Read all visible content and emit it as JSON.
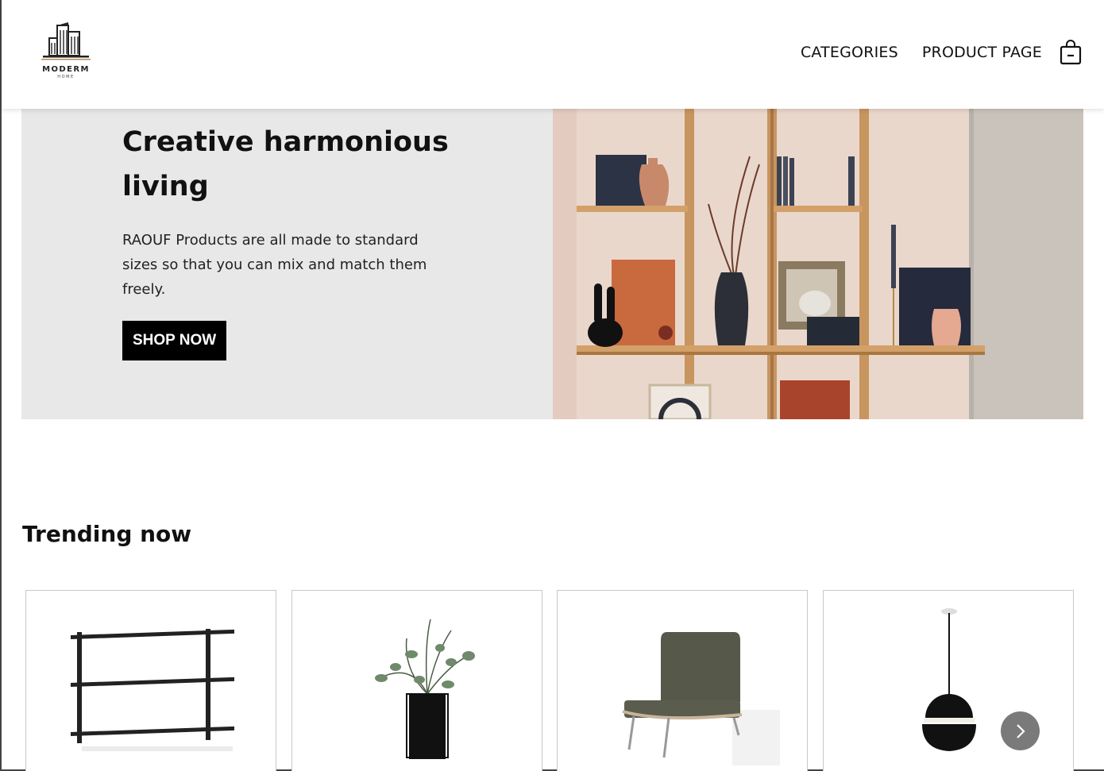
{
  "brand": {
    "name": "MODERM",
    "tagline": "HOME"
  },
  "nav": {
    "categories": "CATEGORIES",
    "product_page": "PRODUCT PAGE",
    "cart_icon": "shopping-bag-icon"
  },
  "hero": {
    "title": "Creative harmonious living",
    "description": "RAOUF Products are all made to standard sizes so that you can mix and match them freely.",
    "cta": "SHOP NOW",
    "background": "#e8e8e8"
  },
  "trending": {
    "title": "Trending now",
    "products": [
      {
        "icon": "wall-shelf-image"
      },
      {
        "icon": "vase-plant-image"
      },
      {
        "icon": "lounge-chair-image"
      },
      {
        "icon": "pendant-lamp-image"
      }
    ],
    "next_icon": "chevron-right-icon"
  }
}
